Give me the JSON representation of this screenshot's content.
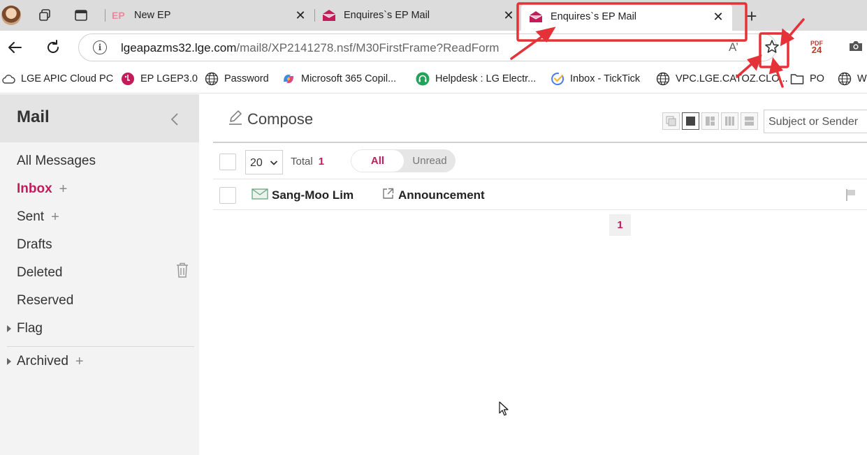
{
  "tabs": [
    {
      "title": "New EP",
      "favicon": "ep-logo-icon"
    },
    {
      "title": "Enquires`s EP Mail",
      "favicon": "mail-envelope-icon"
    },
    {
      "title": "Enquires`s EP Mail",
      "favicon": "mail-envelope-icon",
      "active": true
    }
  ],
  "address_bar": {
    "host": "lgeapazms32.lge.com",
    "path": "/mail8/XP2141278.nsf/M30FirstFrame?ReadForm",
    "read_aloud": "A’"
  },
  "toolbar": {
    "pdf_label": "PDF",
    "pdf_number": "24"
  },
  "bookmarks": [
    {
      "label": "LGE APIC Cloud PC",
      "icon": "cloud-icon"
    },
    {
      "label": "EP LGEP3.0",
      "icon": "lg-logo-icon"
    },
    {
      "label": "Password",
      "icon": "globe-icon"
    },
    {
      "label": "Microsoft 365 Copil...",
      "icon": "copilot-icon"
    },
    {
      "label": "Helpdesk : LG Electr...",
      "icon": "headset-icon"
    },
    {
      "label": "Inbox - TickTick",
      "icon": "ticktick-icon"
    },
    {
      "label": "VPC.LGE.CATOZ.CLO...",
      "icon": "globe-icon"
    },
    {
      "label": "PO",
      "icon": "folder-icon"
    },
    {
      "label": "W",
      "icon": "globe-icon"
    }
  ],
  "sidebar": {
    "title": "Mail",
    "folders": [
      {
        "label": "All Messages"
      },
      {
        "label": "Inbox",
        "active": true,
        "plus": "+"
      },
      {
        "label": "Sent",
        "plus": "+"
      },
      {
        "label": "Drafts"
      },
      {
        "label": "Deleted"
      },
      {
        "label": "Reserved"
      },
      {
        "label": "Flag"
      },
      {
        "label": "Archived",
        "plus": "+"
      }
    ]
  },
  "main": {
    "compose_label": "Compose",
    "search_scope": "Subject or Sender",
    "page_size": "20",
    "total_label": "Total",
    "total_count": "1",
    "filter_all": "All",
    "filter_unread": "Unread",
    "messages": [
      {
        "sender": "Sang-Moo Lim",
        "subject": "Announcement"
      }
    ],
    "current_page": "1"
  },
  "colors": {
    "accent": "#c41b5a",
    "annotation": "#e53238"
  }
}
